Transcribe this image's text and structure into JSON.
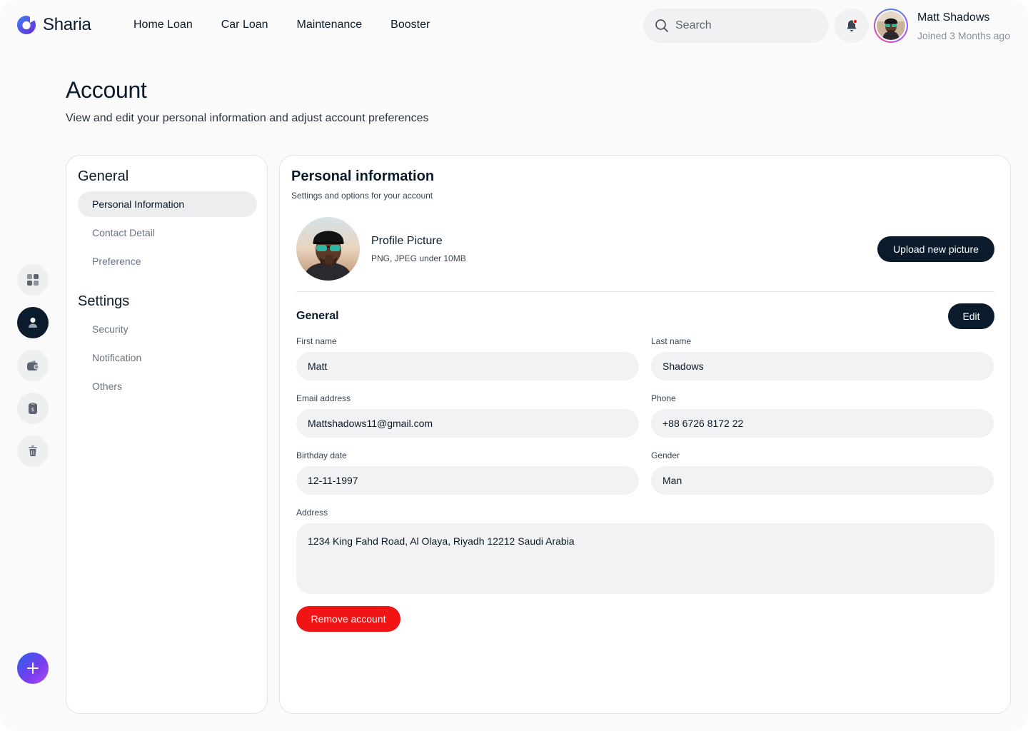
{
  "app": {
    "name": "Sharia"
  },
  "nav": {
    "items": [
      {
        "label": "Home Loan"
      },
      {
        "label": "Car Loan"
      },
      {
        "label": "Maintenance"
      },
      {
        "label": "Booster"
      }
    ]
  },
  "search": {
    "placeholder": "Search"
  },
  "user": {
    "name": "Matt Shadows",
    "joined": "Joined 3 Months ago"
  },
  "rail": {
    "icons": [
      "dashboard-icon",
      "user-icon",
      "wallet-icon",
      "clipboard-icon",
      "trash-icon"
    ],
    "active": "user-icon",
    "fab_icon": "plus-icon"
  },
  "page": {
    "title": "Account",
    "subtitle": "View and edit your personal information and adjust account preferences"
  },
  "menu": {
    "general_heading": "General",
    "general_items": [
      {
        "label": "Personal Information",
        "active": true
      },
      {
        "label": "Contact Detail",
        "active": false
      },
      {
        "label": "Preference",
        "active": false
      }
    ],
    "settings_heading": "Settings",
    "settings_items": [
      {
        "label": "Security"
      },
      {
        "label": "Notification"
      },
      {
        "label": "Others"
      }
    ]
  },
  "main": {
    "title": "Personal information",
    "subtitle": "Settings and options for your account",
    "profile": {
      "title": "Profile Picture",
      "hint": "PNG, JPEG under 10MB",
      "upload_label": "Upload new picture"
    },
    "general": {
      "title": "General",
      "edit_label": "Edit",
      "fields": {
        "first_name": {
          "label": "First name",
          "value": "Matt"
        },
        "last_name": {
          "label": "Last name",
          "value": "Shadows"
        },
        "email": {
          "label": "Email address",
          "value": "Mattshadows11@gmail.com"
        },
        "phone": {
          "label": "Phone",
          "value": "+88 6726 8172 22"
        },
        "birthday": {
          "label": "Birthday date",
          "value": "12-11-1997"
        },
        "gender": {
          "label": "Gender",
          "value": "Man"
        },
        "address": {
          "label": "Address",
          "value": "1234 King Fahd Road, Al Olaya, Riyadh 12212 Saudi Arabia"
        }
      }
    },
    "remove_label": "Remove account"
  },
  "colors": {
    "primary": "#0b1b2b",
    "danger": "#f01414",
    "accent_gradient_start": "#2563eb",
    "accent_gradient_end": "#a855f7"
  }
}
